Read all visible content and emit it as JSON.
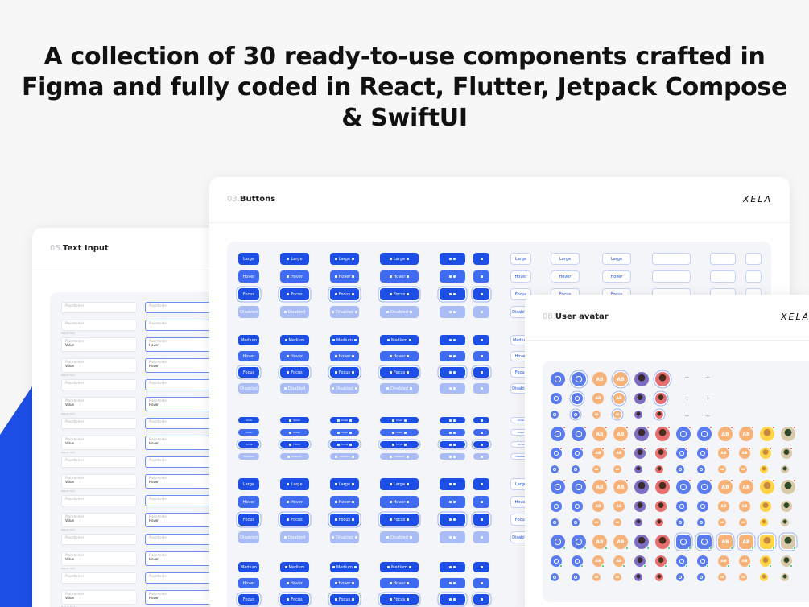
{
  "headline": {
    "line1": "A collection of 30 ready-to-use components crafted in",
    "line2": "Figma and fully coded in React, Flutter, Jetpack Compose",
    "line3": "& SwiftUI"
  },
  "colors": {
    "accent": "#1d4ee6",
    "hover": "#3e6bf0",
    "disabled": "#a9bcf6",
    "avatar_orange": "#f7b27a"
  },
  "text_input_card": {
    "number": "05.",
    "title": "Text Input",
    "placeholder": "Placeholder",
    "value": "Value",
    "hover": "Hover",
    "helper": "Helper Text"
  },
  "buttons_card": {
    "number": "03.",
    "title": "Buttons",
    "logo": "XELA",
    "labels": {
      "large": "Large",
      "medium": "Medium",
      "small": "Small",
      "hover": "Hover",
      "focus": "Focus",
      "disabled": "Disabled"
    }
  },
  "avatar_card": {
    "number": "08.",
    "title": "User avatar",
    "logo": "XELA",
    "initials": "AB",
    "plus": "+"
  }
}
